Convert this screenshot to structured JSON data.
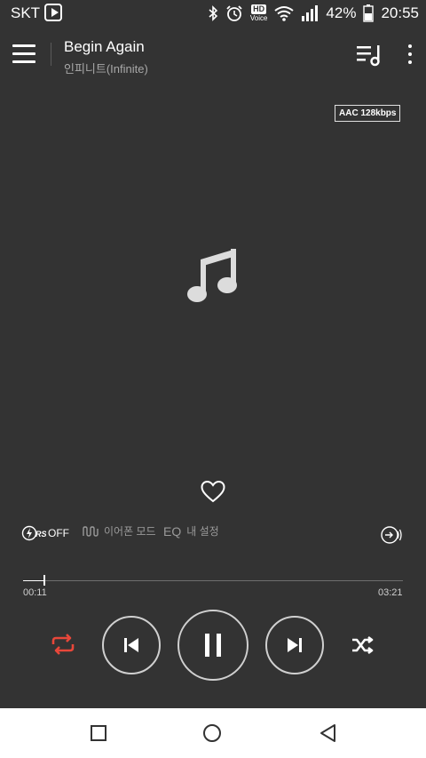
{
  "status_bar": {
    "carrier": "SKT",
    "hd_label": "HD",
    "voice_label": "Voice",
    "battery": "42%",
    "time": "20:55",
    "icons": [
      "play-badge-icon",
      "bluetooth-icon",
      "alarm-icon",
      "wifi-icon",
      "signal-icon",
      "battery-icon"
    ]
  },
  "header": {
    "title": "Begin Again",
    "artist": "인피니트(Infinite)"
  },
  "codec_badge": "AAC 128kbps",
  "features": {
    "rs_label": "OFF",
    "earphone_mode": "이어폰 모드",
    "eq_label": "EQ",
    "eq_setting": "내 설정"
  },
  "progress": {
    "elapsed": "00:11",
    "total": "03:21",
    "fraction": 0.055
  },
  "colors": {
    "background": "#333333",
    "repeat_active": "#e8473a",
    "navbar": "#ffffff"
  }
}
